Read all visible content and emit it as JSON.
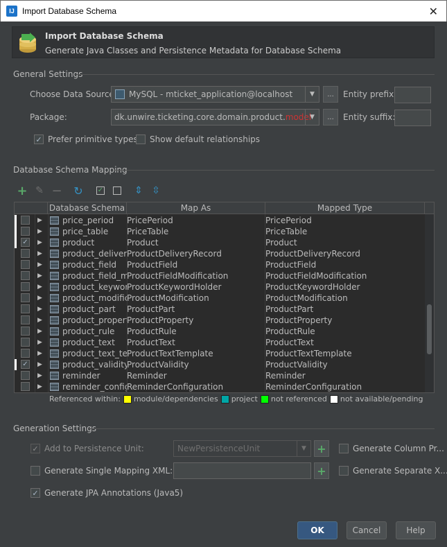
{
  "window": {
    "title": "Import Database Schema",
    "app_icon": "intellij-icon",
    "close_glyph": "✕"
  },
  "header": {
    "title": "Import Database Schema",
    "subtitle": "Generate Java Classes and Persistence Metadata for Database Schema",
    "icon": "database-import-icon"
  },
  "general": {
    "section_title": "General Settings",
    "data_source_label": "Choose Data Source:",
    "data_source_value": "MySQL - mticket_application@localhost",
    "package_label": "Package:",
    "package_value_prefix": "dk.unwire.ticketing.core.domain.product.",
    "package_value_highlight": "model",
    "highlight_color": "#cc3333",
    "entity_prefix_label": "Entity prefix:",
    "entity_suffix_label": "Entity suffix:",
    "entity_prefix_value": "",
    "entity_suffix_value": "",
    "ellipsis": "...",
    "prefer_primitive_label": "Prefer primitive types",
    "prefer_primitive_checked": true,
    "show_default_rel_label": "Show default relationships",
    "show_default_rel_checked": false
  },
  "mapping": {
    "section_title": "Database Schema Mapping",
    "columns": [
      "Database Schema",
      "Map As",
      "Mapped Type"
    ],
    "rows": [
      {
        "name": "price_period",
        "map_as": "PricePeriod",
        "mapped_type": "PricePeriod",
        "checked": false,
        "marked": true
      },
      {
        "name": "price_table",
        "map_as": "PriceTable",
        "mapped_type": "PriceTable",
        "checked": false,
        "marked": true
      },
      {
        "name": "product",
        "map_as": "Product",
        "mapped_type": "Product",
        "checked": true,
        "marked": true
      },
      {
        "name": "product_delivery_",
        "map_as": "ProductDeliveryRecord",
        "mapped_type": "ProductDeliveryRecord",
        "checked": false,
        "marked": false
      },
      {
        "name": "product_field",
        "map_as": "ProductField",
        "mapped_type": "ProductField",
        "checked": false,
        "marked": false
      },
      {
        "name": "product_field_mc",
        "map_as": "ProductFieldModification",
        "mapped_type": "ProductFieldModification",
        "checked": false,
        "marked": false
      },
      {
        "name": "product_keyword",
        "map_as": "ProductKeywordHolder",
        "mapped_type": "ProductKeywordHolder",
        "checked": false,
        "marked": false
      },
      {
        "name": "product_modifica",
        "map_as": "ProductModification",
        "mapped_type": "ProductModification",
        "checked": false,
        "marked": false
      },
      {
        "name": "product_part",
        "map_as": "ProductPart",
        "mapped_type": "ProductPart",
        "checked": false,
        "marked": false
      },
      {
        "name": "product_property",
        "map_as": "ProductProperty",
        "mapped_type": "ProductProperty",
        "checked": false,
        "marked": false
      },
      {
        "name": "product_rule",
        "map_as": "ProductRule",
        "mapped_type": "ProductRule",
        "checked": false,
        "marked": false
      },
      {
        "name": "product_text",
        "map_as": "ProductText",
        "mapped_type": "ProductText",
        "checked": false,
        "marked": false
      },
      {
        "name": "product_text_tem",
        "map_as": "ProductTextTemplate",
        "mapped_type": "ProductTextTemplate",
        "checked": false,
        "marked": false
      },
      {
        "name": "product_validity",
        "map_as": "ProductValidity",
        "mapped_type": "ProductValidity",
        "checked": true,
        "marked": true
      },
      {
        "name": "reminder",
        "map_as": "Reminder",
        "mapped_type": "Reminder",
        "checked": false,
        "marked": false
      },
      {
        "name": "reminder_configu",
        "map_as": "ReminderConfiguration",
        "mapped_type": "ReminderConfiguration",
        "checked": false,
        "marked": false
      }
    ],
    "legend": {
      "prefix": "Referenced within:",
      "items": [
        {
          "label": "module/dependencies",
          "color": "#ffff00"
        },
        {
          "label": "project",
          "color": "#00a6a6"
        },
        {
          "label": "not referenced",
          "color": "#00ff00"
        },
        {
          "label": "not available/pending",
          "color": "#ffffff"
        }
      ]
    }
  },
  "generation": {
    "section_title": "Generation Settings",
    "add_to_pu_label": "Add to Persistence Unit:",
    "add_to_pu_checked": true,
    "pu_value": "NewPersistenceUnit",
    "single_mapping_label": "Generate Single Mapping XML:",
    "single_mapping_checked": false,
    "single_mapping_value": "",
    "jpa_annotations_label": "Generate JPA Annotations (Java5)",
    "jpa_annotations_checked": true,
    "gen_column_props_label": "Generate Column Pr...",
    "gen_column_props_checked": false,
    "gen_separate_label": "Generate Separate X...",
    "gen_separate_checked": false
  },
  "buttons": {
    "ok": "OK",
    "cancel": "Cancel",
    "help": "Help"
  }
}
